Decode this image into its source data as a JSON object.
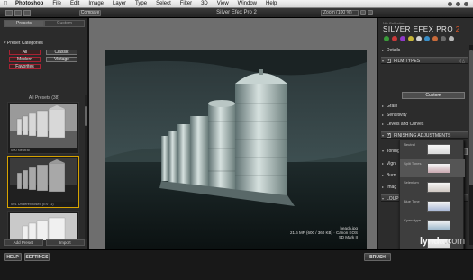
{
  "menubar": {
    "app": "Photoshop",
    "items": [
      "File",
      "Edit",
      "Image",
      "Layer",
      "Type",
      "Select",
      "Filter",
      "3D",
      "View",
      "Window",
      "Help"
    ]
  },
  "window": {
    "title": "Silver Efex Pro 2",
    "compare_label": "Compare",
    "zoom_label": "Zoom (100 %)"
  },
  "left_panel": {
    "tabs": [
      {
        "label": "Presets",
        "active": true
      },
      {
        "label": "Custom",
        "active": false
      }
    ],
    "categories_title": "Preset Categories",
    "categories": [
      {
        "label": "All",
        "selected": true
      },
      {
        "label": "Classic",
        "selected": false
      },
      {
        "label": "Modern",
        "selected": true
      },
      {
        "label": "Vintage",
        "selected": false
      },
      {
        "label": "Favorites",
        "selected": true
      }
    ],
    "all_presets_label": "All Presets (38)",
    "thumbnails": [
      {
        "caption": "000 Neutral",
        "selected": false
      },
      {
        "caption": "001 Underexposed (EV -1)",
        "selected": true
      },
      {
        "caption": "",
        "selected": false
      }
    ],
    "add_preset_label": "Add Preset",
    "import_label": "Import"
  },
  "canvas": {
    "photo_info_line1": "beach.jpg",
    "photo_info_line2": "21.6 MP (600 / 360 KB) · Canon EOS 5D Mark II"
  },
  "right_panel": {
    "brand_small": "Nik Collection",
    "brand": "SILVER EFEX PRO",
    "brand_version": "2",
    "dot_colors": [
      "#3a9b3a",
      "#c83a3a",
      "#8f3ac8",
      "#c8b63a",
      "#d1d1d1",
      "#3a8fc8",
      "#c86a3a",
      "#6a6a6a",
      "#b8b8b8"
    ],
    "sections": [
      {
        "label": "Details",
        "type": "collapsed"
      },
      {
        "label": "FILM TYPES",
        "type": "header"
      },
      {
        "label": "Grain",
        "type": "collapsed"
      },
      {
        "label": "Sensitivity",
        "type": "collapsed"
      },
      {
        "label": "Levels and Curves",
        "type": "collapsed"
      },
      {
        "label": "FINISHING ADJUSTMENTS",
        "type": "header"
      },
      {
        "label": "Toning",
        "type": "expanded"
      },
      {
        "label": "Vign",
        "type": "collapsed"
      },
      {
        "label": "Burn",
        "type": "collapsed"
      },
      {
        "label": "Imag",
        "type": "collapsed"
      },
      {
        "label": "LOUP",
        "type": "header"
      }
    ],
    "film_type_value": "Custom"
  },
  "toning_menu": [
    {
      "label": "Neutral",
      "swatch": "#d9d9d9",
      "highlighted": false
    },
    {
      "label": "Split Tones",
      "swatch": "#c9a9b0",
      "highlighted": true
    },
    {
      "label": "Selenium",
      "swatch": "#cfc8c2",
      "highlighted": false
    },
    {
      "label": "Blue Tone",
      "swatch": "#aab9d6",
      "highlighted": false
    },
    {
      "label": "Cyanotype",
      "swatch": "#9fb9cc",
      "highlighted": false
    },
    {
      "label": "",
      "swatch": "#d6d6d6",
      "highlighted": false
    }
  ],
  "bottom_bar": {
    "help_label": "HELP",
    "settings_label": "SETTINGS",
    "brush_label": "BRUSH"
  },
  "watermark": {
    "text": "lynda",
    "suffix": ".com"
  }
}
